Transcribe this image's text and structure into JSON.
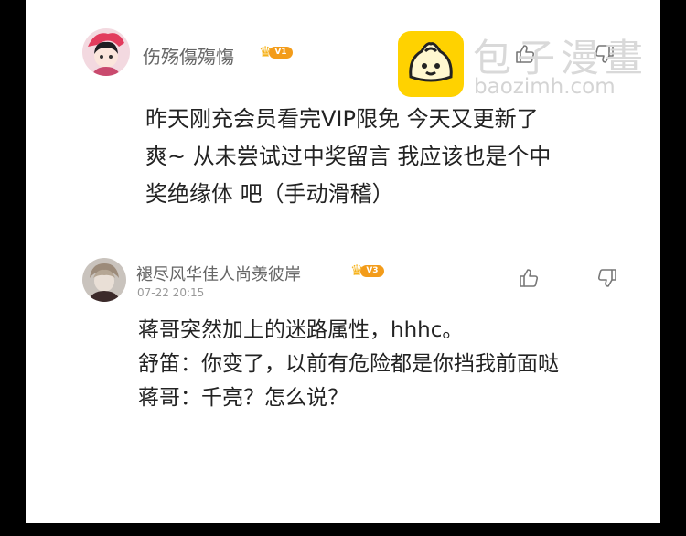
{
  "watermark": {
    "brand": "包子漫畫",
    "url": "baozimh.com"
  },
  "comments": [
    {
      "username": "伤殇傷殤慯",
      "level": "V1",
      "date": "",
      "lines": [
        "昨天刚充会员看完VIP限免  今天又更新了",
        "爽~  从未尝试过中奖留言  我应该也是个中",
        "奖绝缘体 吧（手动滑稽）"
      ]
    },
    {
      "username": "褪尽风华佳人尚羡彼岸",
      "level": "V3",
      "date": "07-22 20:15",
      "lines": [
        "蒋哥突然加上的迷路属性，hhhc。",
        "舒笛：你变了，以前有危险都是你挡我前面哒",
        "蒋哥：千亮？怎么说？"
      ]
    }
  ],
  "colors": {
    "badge": "#f39c1a",
    "crown": "#f6b21a",
    "watermark_logo": "#ffd200"
  }
}
